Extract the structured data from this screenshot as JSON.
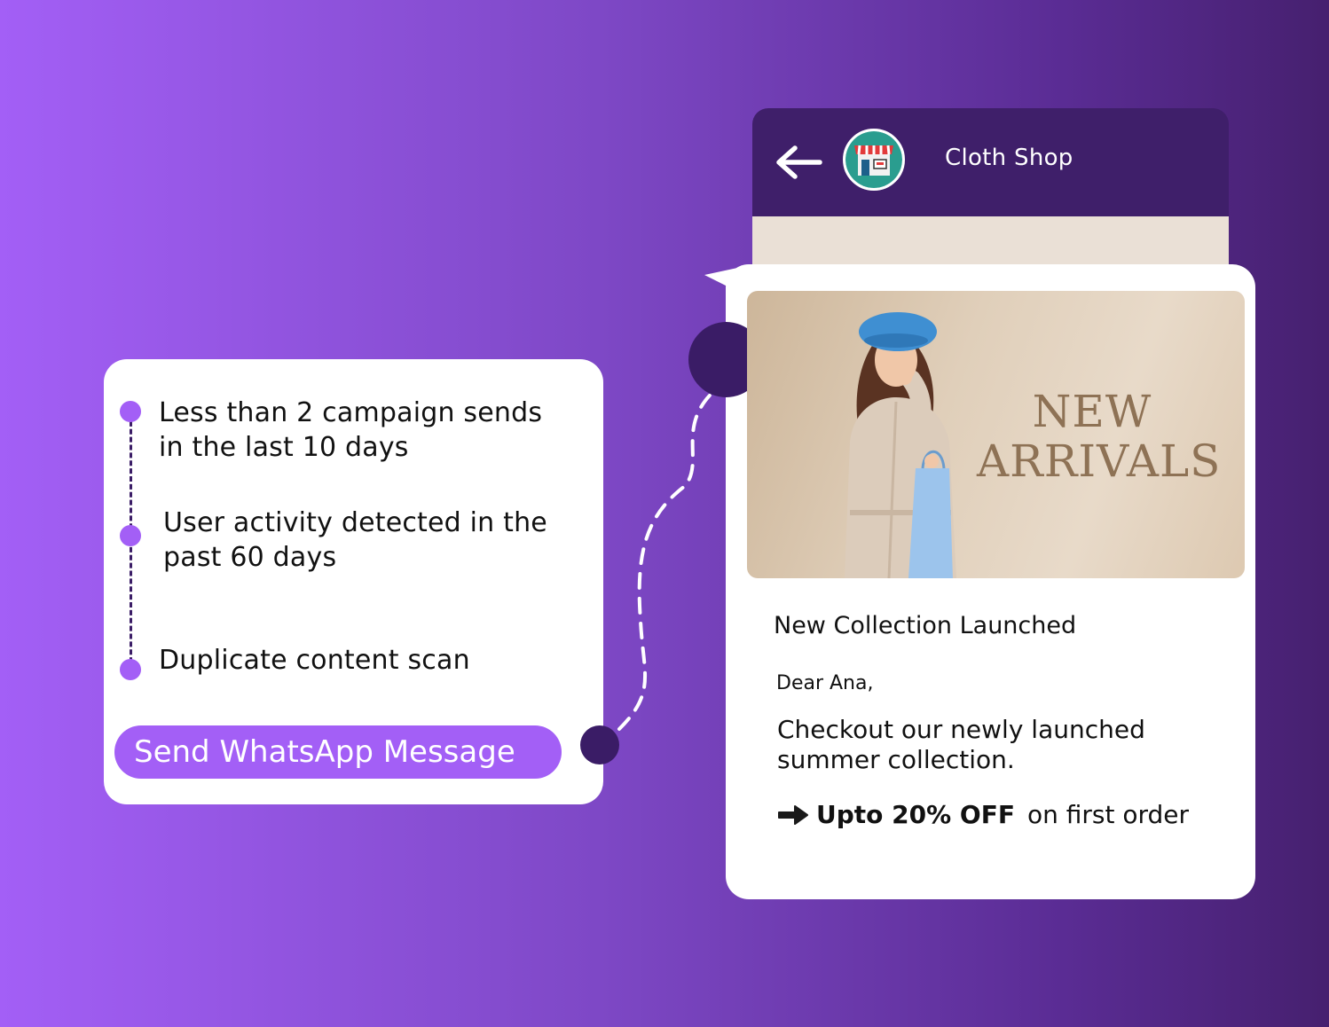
{
  "rules": {
    "items": [
      {
        "label": "Less than 2 campaign sends in the last 10 days",
        "line1": "Less than 2 campaign sends",
        "line2": "in the last 10 days"
      },
      {
        "label": "User activity detected in the past 60 days",
        "line1": "User activity detected in the",
        "line2": "past 60 days"
      },
      {
        "label": "Duplicate content scan",
        "line1": "Duplicate content scan",
        "line2": ""
      }
    ],
    "action_button": "Send WhatsApp Message"
  },
  "chat": {
    "shop_name": "Cloth Shop",
    "back_icon": "back-arrow-icon",
    "avatar_icon": "storefront-icon",
    "banner": {
      "headline_line1": "NEW",
      "headline_line2": "ARRIVALS"
    },
    "message": {
      "title": "New Collection Launched",
      "greeting": "Dear Ana,",
      "body": "Checkout our newly launched summer collection.",
      "offer_bold": "Upto 20% OFF",
      "offer_rest": "on first order"
    }
  },
  "colors": {
    "accent": "#a35ff6",
    "header": "#3f1f6a",
    "connector": "#3a1c66"
  }
}
